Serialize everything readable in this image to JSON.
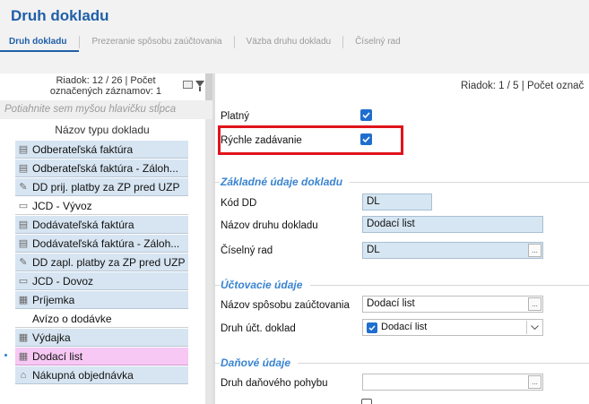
{
  "app": {
    "title": "Druh dokladu"
  },
  "tabs": [
    {
      "label": "Druh dokladu",
      "active": true
    },
    {
      "label": "Prezeranie spôsobu zaúčtovania",
      "active": false
    },
    {
      "label": "Väzba druhu dokladu",
      "active": false
    },
    {
      "label": "Číselný rad",
      "active": false
    }
  ],
  "left_panel": {
    "status_line1": "Riadok: 12 / 26 | Počet",
    "status_line2": "označených záznamov: 1",
    "group_hint": "Potiahnite sem myšou hlavičku stĺpca",
    "column_header": "Názov typu dokladu",
    "rows": [
      {
        "label": "Odberateľská faktúra",
        "icon": "invoice-icon"
      },
      {
        "label": "Odberateľská faktúra - Záloh...",
        "icon": "invoice-icon"
      },
      {
        "label": "DD prij. platby za ZP pred UZP",
        "icon": "pencil-icon"
      },
      {
        "label": "JCD - Vývoz",
        "icon": "document-icon"
      },
      {
        "label": "Dodávateľská faktúra",
        "icon": "invoice-icon"
      },
      {
        "label": "Dodávateľská faktúra - Záloh...",
        "icon": "invoice-icon"
      },
      {
        "label": "DD zapl. platby za ZP pred UZP",
        "icon": "pencil-icon"
      },
      {
        "label": "JCD - Dovoz",
        "icon": "document-icon"
      },
      {
        "label": "Príjemka",
        "icon": "receipt-icon"
      },
      {
        "label": "Avízo o dodávke",
        "icon": ""
      },
      {
        "label": "Výdajka",
        "icon": "receipt-icon"
      },
      {
        "label": "Dodací list",
        "icon": "receipt-icon"
      },
      {
        "label": "Nákupná objednávka",
        "icon": "cart-icon"
      }
    ]
  },
  "right_panel": {
    "status": "Riadok: 1 / 5 | Počet označ",
    "platny": {
      "label": "Platný",
      "checked": true
    },
    "rychle": {
      "label": "Rýchle zadávanie",
      "checked": true
    },
    "sections": {
      "basic": "Základné údaje dokladu",
      "accounting": "Účtovacie údaje",
      "tax": "Daňové údaje"
    },
    "fields": {
      "kod_dd": {
        "label": "Kód DD",
        "value": "DL"
      },
      "nazov_druhu": {
        "label": "Názov druhu dokladu",
        "value": "Dodací list"
      },
      "ciselny_rad": {
        "label": "Číselný rad",
        "value": "DL"
      },
      "nazov_sposobu": {
        "label": "Názov spôsobu zaúčtovania",
        "value": "Dodací list"
      },
      "druh_uct": {
        "label": "Druh účt. doklad",
        "value": "Dodací list"
      },
      "druh_danoveho": {
        "label": "Druh daňového pohybu",
        "value": ""
      }
    },
    "ellipsis": "..."
  },
  "colors": {
    "accent": "#1f5fa8",
    "section": "#3a84d0",
    "row": "#d7e5f2",
    "selected_row": "#f7c8f4",
    "highlight": "#e0141b"
  }
}
